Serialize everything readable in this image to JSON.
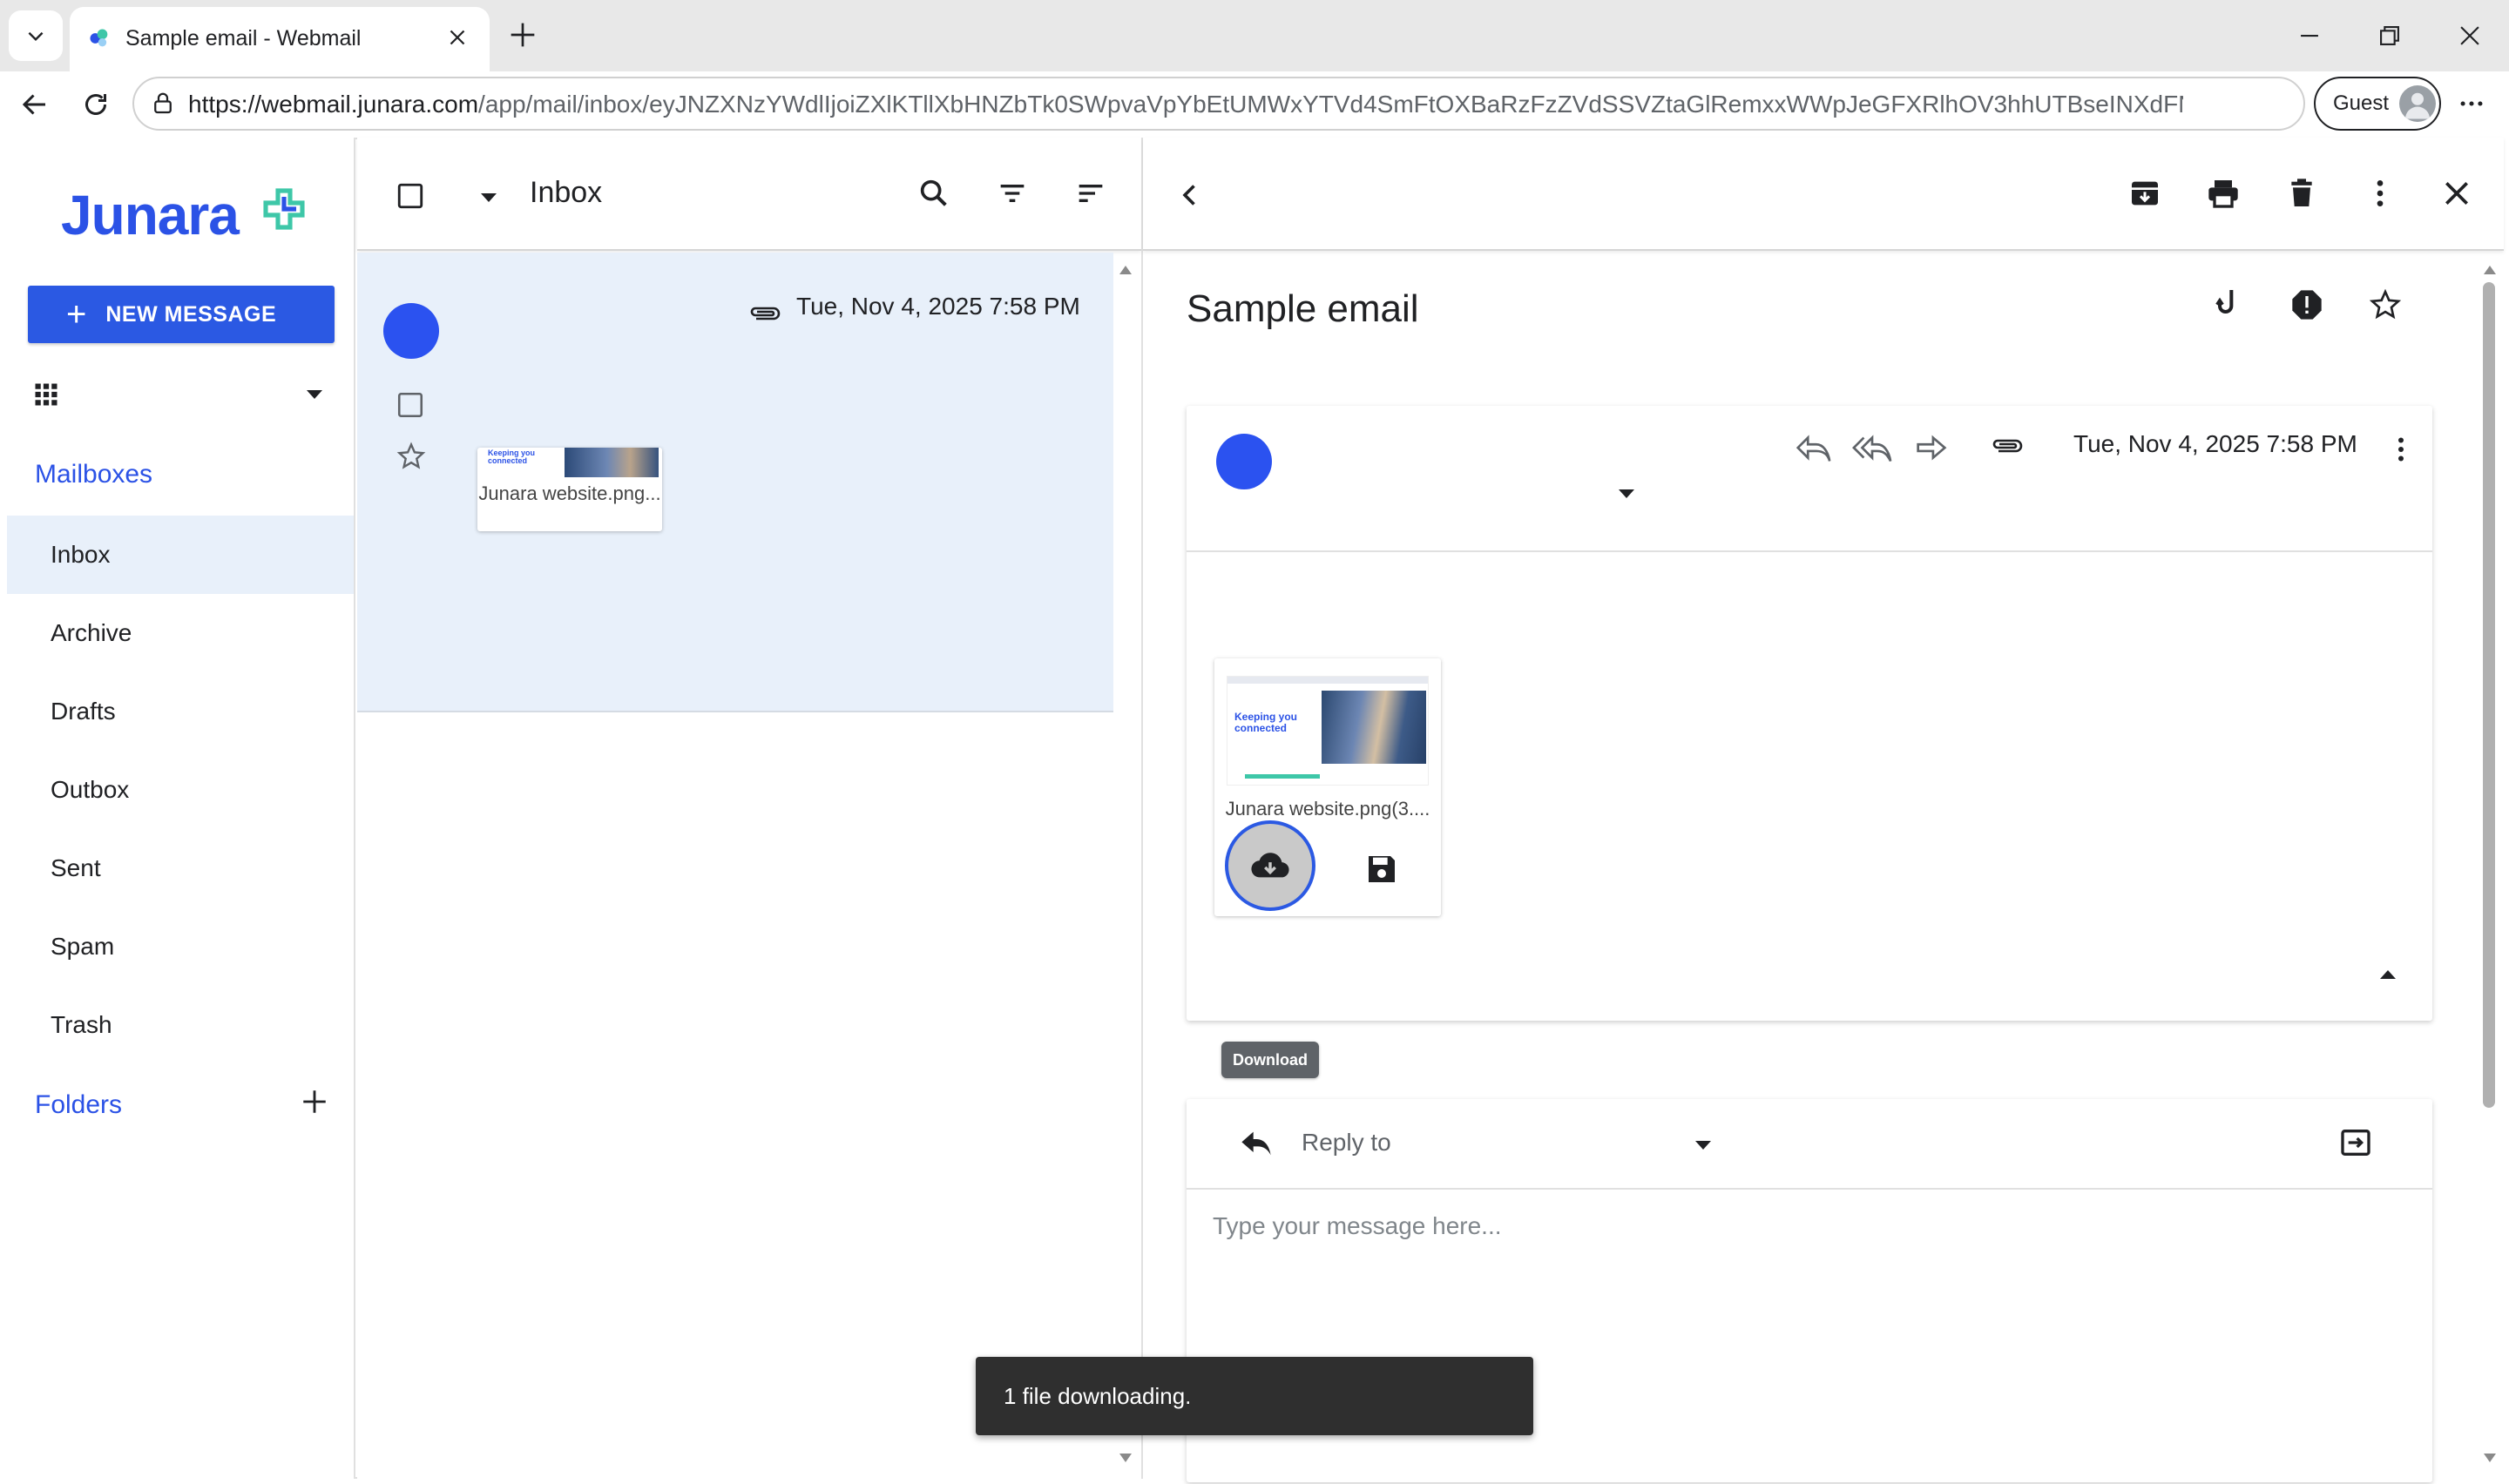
{
  "browser": {
    "tab_title": "Sample email - Webmail",
    "url_host": "https://webmail.junara.com",
    "url_path": "/app/mail/inbox/eyJNZXNzYWdlIjoiZXlKTllXbHNZbTk0SWpvaVpYbEtUMWxYTVd4SmFtOXBaRzFzZVdSSVZtaGlRemxxWWpJeGFXRlhOV3hhUTBseINXdFNiR0pIYkhSaF...",
    "profile_label": "Guest",
    "icons": [
      "chevron-down-icon",
      "webmail-favicon",
      "close-icon",
      "plus-icon",
      "minimize-icon",
      "restore-icon",
      "back-arrow-icon",
      "reload-icon",
      "site-info-icon",
      "profile-avatar-icon",
      "kebab-menu-icon"
    ]
  },
  "app": {
    "brand": "Junara",
    "brand_color": "#2b52e6",
    "new_message_label": "NEW MESSAGE",
    "mailboxes_heading": "Mailboxes",
    "mailboxes": [
      {
        "label": "Inbox",
        "active": true
      },
      {
        "label": "Archive"
      },
      {
        "label": "Drafts"
      },
      {
        "label": "Outbox"
      },
      {
        "label": "Sent"
      },
      {
        "label": "Spam"
      },
      {
        "label": "Trash"
      }
    ],
    "folders_heading": "Folders"
  },
  "list": {
    "title": "Inbox",
    "rows": [
      {
        "date": "Tue, Nov 4, 2025 7:58 PM",
        "attachment_name": "Junara website.png...",
        "has_attachment": true,
        "selected": true
      }
    ]
  },
  "reader": {
    "subject": "Sample email",
    "date": "Tue, Nov 4, 2025 7:58 PM",
    "attachment_name": "Junara website.png(3....",
    "download_tooltip": "Download",
    "reply_mode_label": "Reply to",
    "reply_placeholder": "Type your message here..."
  },
  "thumbnail": {
    "headline": "Keeping you connected"
  },
  "snackbar": {
    "message": "1 file downloading."
  }
}
